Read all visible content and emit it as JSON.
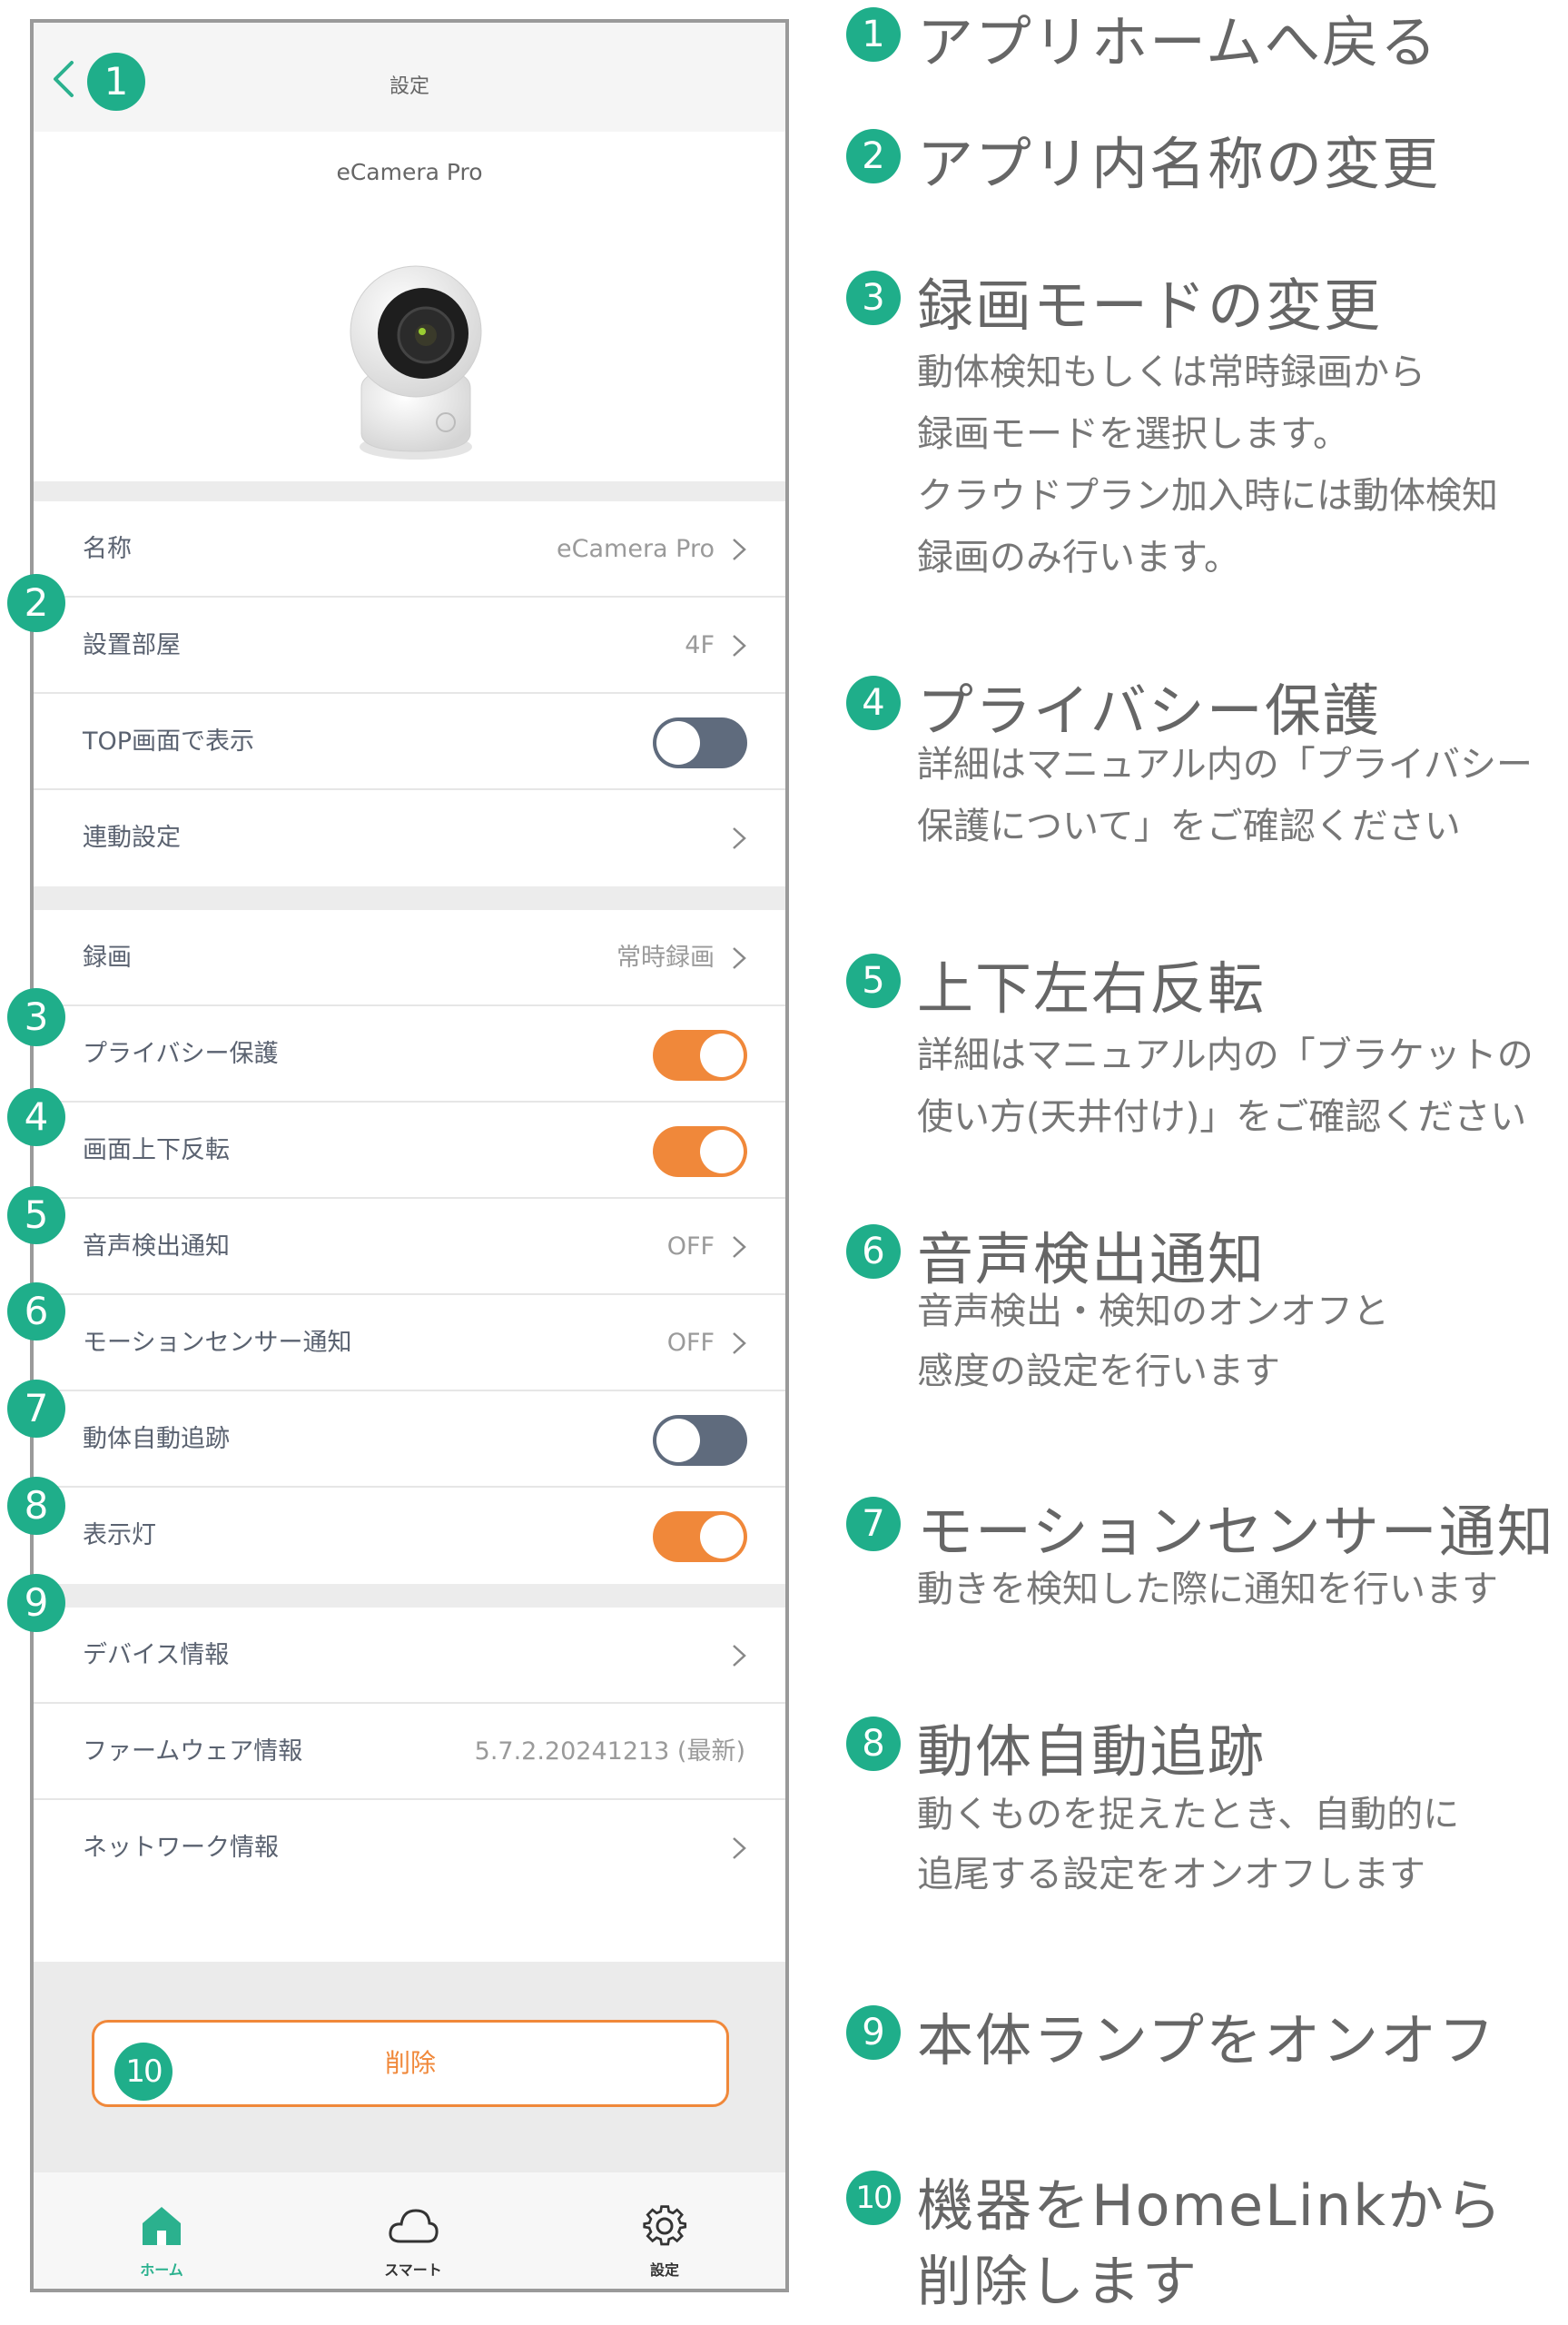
{
  "nav": {
    "title": "設定"
  },
  "device": {
    "name": "eCamera Pro"
  },
  "rows": [
    {
      "label": "名称",
      "value": "eCamera Pro"
    },
    {
      "label": "設置部屋",
      "value": "4F"
    },
    {
      "label": "TOP画面で表示",
      "toggle": false
    },
    {
      "label": "連動設定",
      "value": ""
    },
    {
      "label": "録画",
      "value": "常時録画"
    },
    {
      "label": "プライバシー保護",
      "toggle": true
    },
    {
      "label": "画面上下反転",
      "toggle": true
    },
    {
      "label": "音声検出通知",
      "value": "OFF"
    },
    {
      "label": "モーションセンサー通知",
      "value": "OFF"
    },
    {
      "label": "動体自動追跡",
      "toggle": false
    },
    {
      "label": "表示灯",
      "toggle": true
    },
    {
      "label": "デバイス情報",
      "value": ""
    },
    {
      "label": "ファームウェア情報",
      "value": "5.7.2.20241213 (最新)"
    },
    {
      "label": "ネットワーク情報",
      "value": ""
    }
  ],
  "delete_button": "削除",
  "tabs": [
    {
      "label": "ホーム",
      "icon": "home-icon",
      "active": true
    },
    {
      "label": "スマート",
      "icon": "cloud-icon",
      "active": false
    },
    {
      "label": "設定",
      "icon": "gear-icon",
      "active": false
    }
  ],
  "badges": [
    "1",
    "2",
    "3",
    "4",
    "5",
    "6",
    "7",
    "8",
    "9",
    "10"
  ],
  "annotations": [
    {
      "num": "1",
      "title": "アプリホームへ戻る",
      "desc": []
    },
    {
      "num": "2",
      "title": "アプリ内名称の変更",
      "desc": []
    },
    {
      "num": "3",
      "title": "録画モードの変更",
      "desc": [
        "動体検知もしくは常時録画から",
        "録画モードを選択します。",
        "クラウドプラン加入時には動体検知",
        "録画のみ行います。"
      ]
    },
    {
      "num": "4",
      "title": "プライバシー保護",
      "desc": [
        "詳細はマニュアル内の「プライバシー",
        "保護について」をご確認ください"
      ]
    },
    {
      "num": "5",
      "title": "上下左右反転",
      "desc": [
        "詳細はマニュアル内の「ブラケットの",
        "使い方(天井付け)」をご確認ください"
      ]
    },
    {
      "num": "6",
      "title": "音声検出通知",
      "desc": [
        "音声検出・検知のオンオフと",
        "感度の設定を行います"
      ]
    },
    {
      "num": "7",
      "title": "モーションセンサー通知",
      "desc": [
        "動きを検知した際に通知を行います"
      ]
    },
    {
      "num": "8",
      "title": "動体自動追跡",
      "desc": [
        "動くものを捉えたとき、自動的に",
        "追尾する設定をオンオフします"
      ]
    },
    {
      "num": "9",
      "title": "本体ランプをオンオフ",
      "desc": []
    },
    {
      "num": "10",
      "title": "機器をHomeLinkから",
      "desc": [
        "削除します"
      ]
    }
  ],
  "colors": {
    "accent": "#1fae8a",
    "toggle_on": "#f0883a",
    "toggle_off": "#5f6b7d"
  }
}
